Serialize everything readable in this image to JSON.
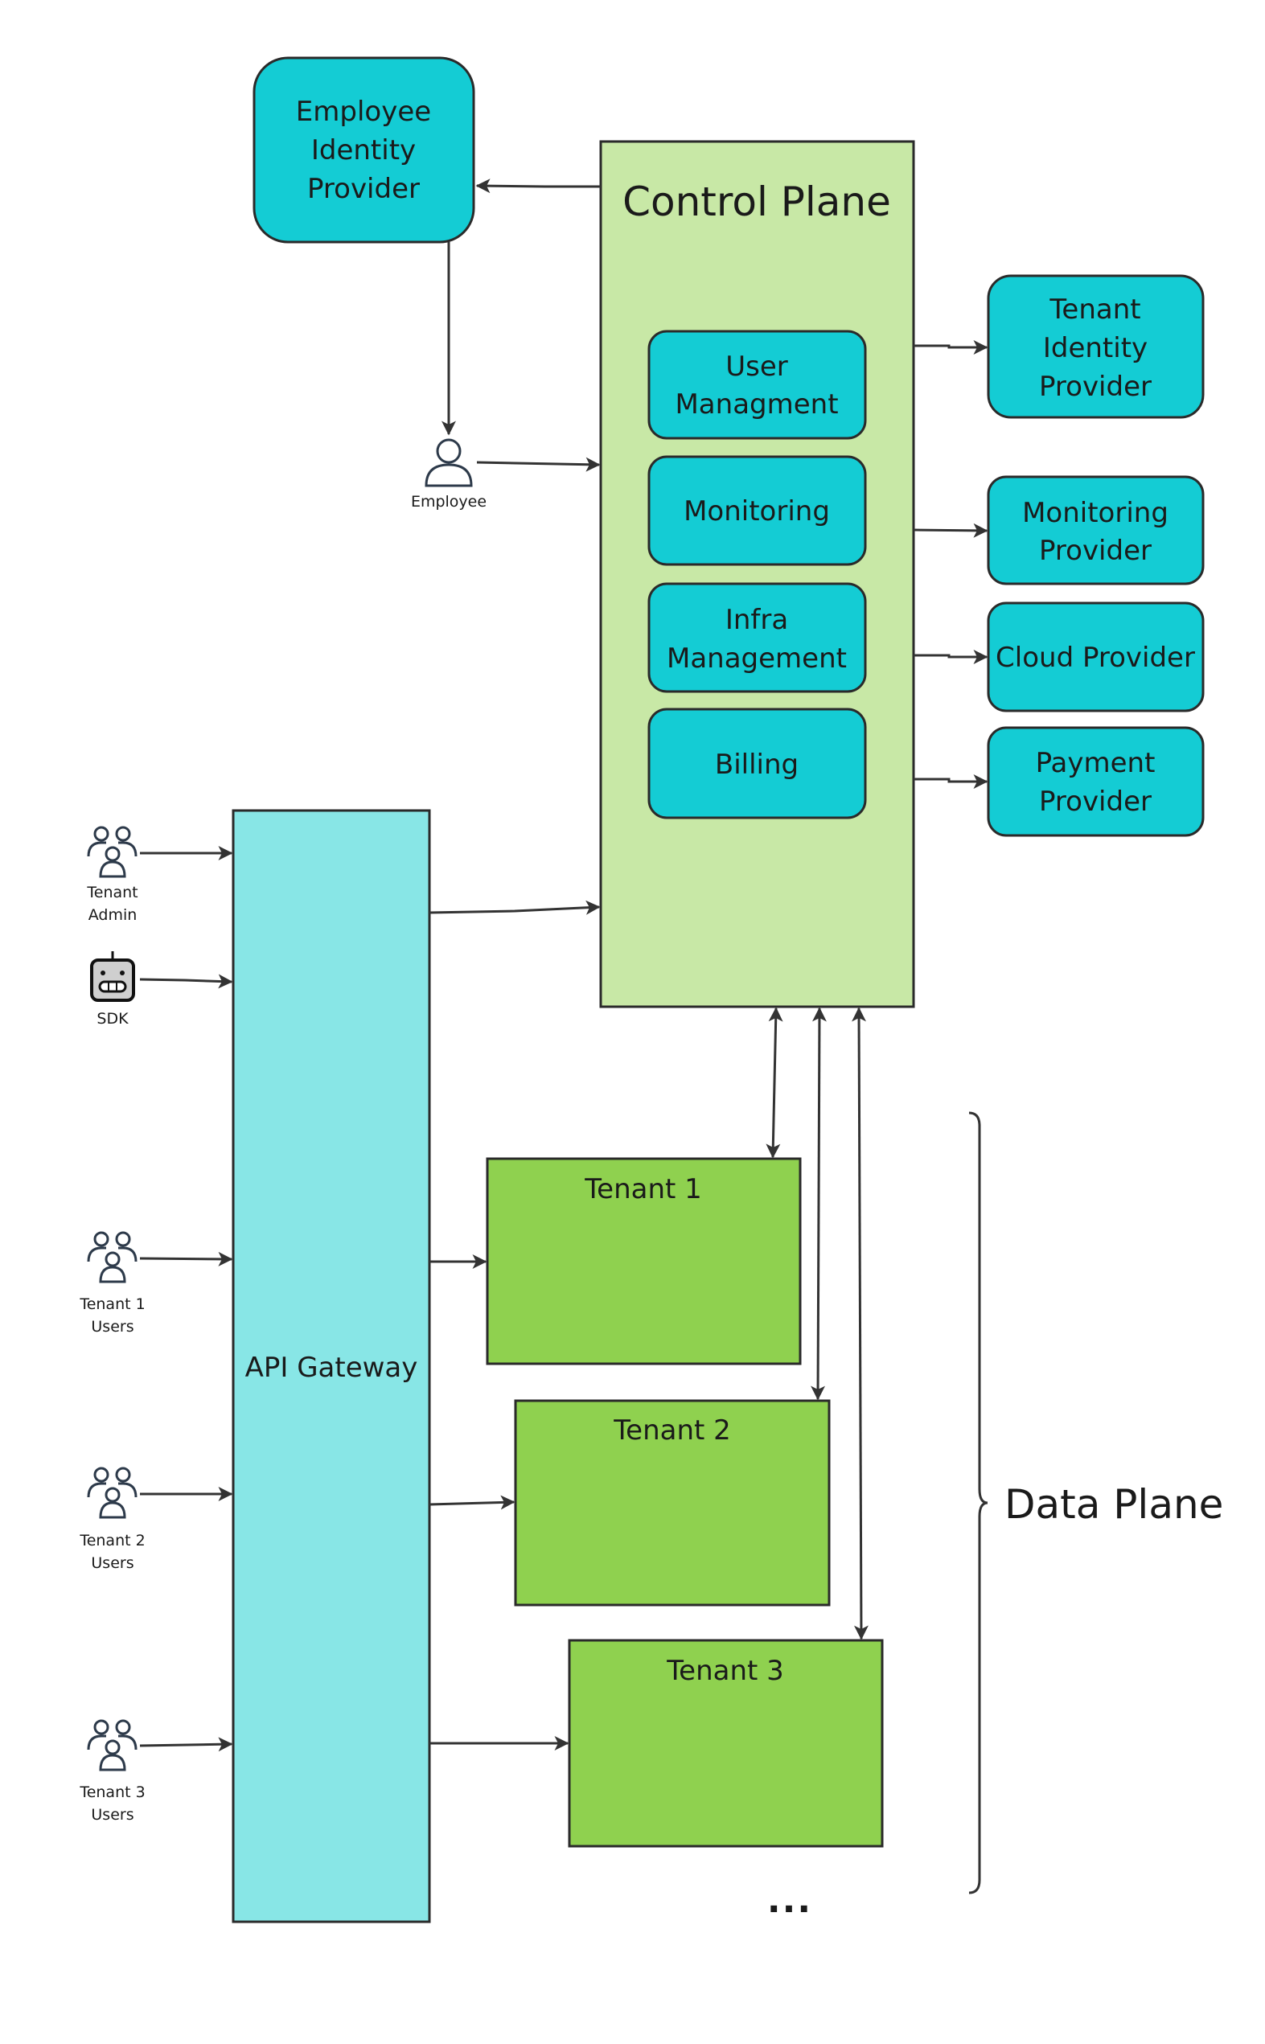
{
  "colors": {
    "service_box": "#14CCD4",
    "control_plane": "#C8E8A6",
    "api_gateway": "#88E6E6",
    "tenant_box": "#8FD14F",
    "line": "#333333"
  },
  "employee_idp": {
    "lines": [
      "Employee",
      "Identity",
      "Provider"
    ]
  },
  "employee": {
    "label": "Employee",
    "icon": "person-icon"
  },
  "control_plane": {
    "title": "Control Plane",
    "modules": [
      {
        "lines": [
          "User",
          "Managment"
        ]
      },
      {
        "lines": [
          "Monitoring"
        ]
      },
      {
        "lines": [
          "Infra",
          "Management"
        ]
      },
      {
        "lines": [
          "Billing"
        ]
      }
    ]
  },
  "providers": [
    {
      "lines": [
        "Tenant",
        "Identity",
        "Provider"
      ]
    },
    {
      "lines": [
        "Monitoring",
        "Provider"
      ]
    },
    {
      "lines": [
        "Cloud Provider"
      ]
    },
    {
      "lines": [
        "Payment",
        "Provider"
      ]
    }
  ],
  "api_gateway": {
    "label": "API Gateway"
  },
  "actors": [
    {
      "lines": [
        "Tenant",
        "Admin"
      ],
      "icon": "user-group-icon"
    },
    {
      "lines": [
        "SDK"
      ],
      "icon": "robot-icon"
    },
    {
      "lines": [
        "Tenant 1",
        "Users"
      ],
      "icon": "user-group-icon"
    },
    {
      "lines": [
        "Tenant 2",
        "Users"
      ],
      "icon": "user-group-icon"
    },
    {
      "lines": [
        "Tenant 3",
        "Users"
      ],
      "icon": "user-group-icon"
    }
  ],
  "tenants": [
    {
      "label": "Tenant 1"
    },
    {
      "label": "Tenant 2"
    },
    {
      "label": "Tenant 3"
    }
  ],
  "more_indicator": "...",
  "data_plane": {
    "label": "Data Plane"
  }
}
